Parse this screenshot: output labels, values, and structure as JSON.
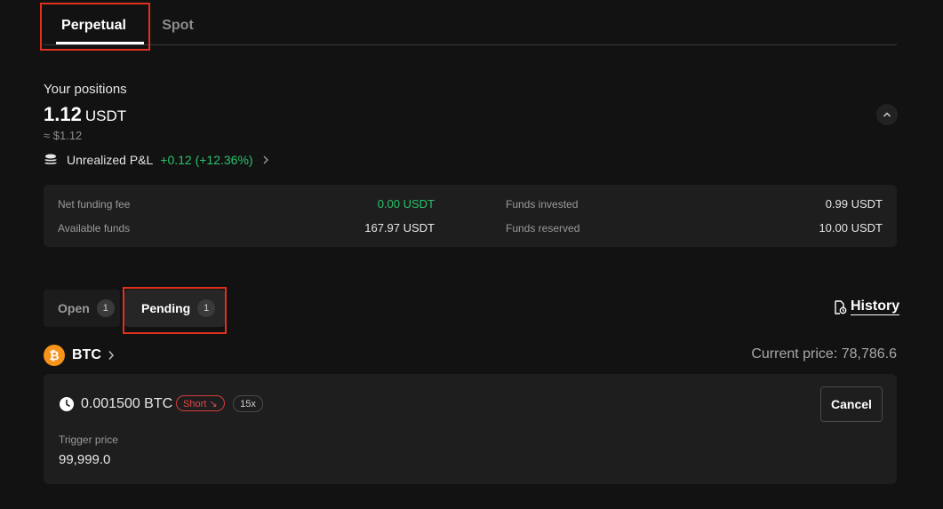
{
  "tabs": {
    "perpetual": "Perpetual",
    "spot": "Spot"
  },
  "positions": {
    "label": "Your positions",
    "amount": "1.12",
    "unit": "USDT",
    "approx": "≈ $1.12",
    "pnl_label": "Unrealized P&L",
    "pnl_value": "+0.12 (+12.36%)"
  },
  "summary": {
    "net_funding_fee_label": "Net funding fee",
    "net_funding_fee_value": "0.00 USDT",
    "available_funds_label": "Available funds",
    "available_funds_value": "167.97 USDT",
    "funds_invested_label": "Funds invested",
    "funds_invested_value": "0.99 USDT",
    "funds_reserved_label": "Funds reserved",
    "funds_reserved_value": "10.00 USDT"
  },
  "order_tabs": {
    "open_label": "Open",
    "open_count": "1",
    "pending_label": "Pending",
    "pending_count": "1",
    "history_label": "History"
  },
  "asset": {
    "symbol": "BTC",
    "logo_glyph": "₿",
    "current_price_label": "Current price: 78,786.6"
  },
  "order": {
    "size": "0.001500 BTC",
    "side": "Short ↘",
    "leverage": "15x",
    "trigger_label": "Trigger price",
    "trigger_value": "99,999.0",
    "cancel_label": "Cancel"
  },
  "colors": {
    "accent_green": "#29c36a",
    "short_red": "#e04848",
    "highlight": "#e0301e",
    "btc_orange": "#f7931a"
  }
}
